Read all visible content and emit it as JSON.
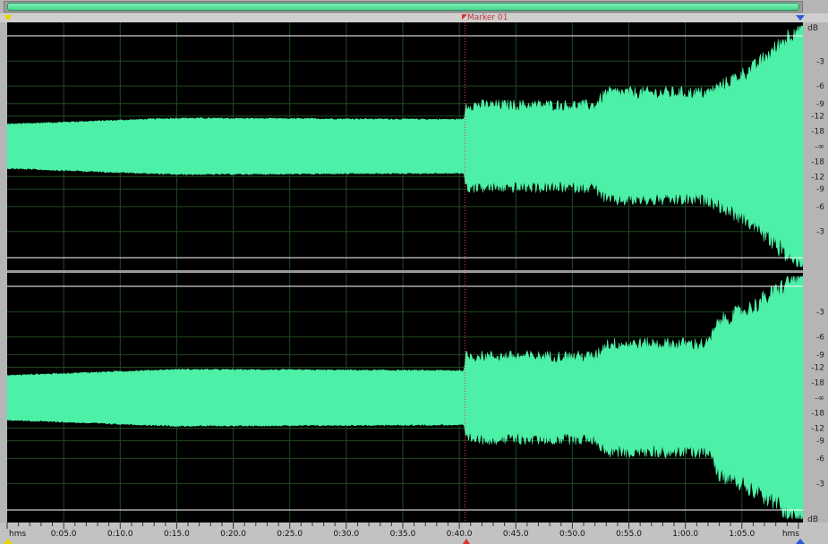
{
  "marker": {
    "label": "Marker 01",
    "time_sec": 40.5
  },
  "colors": {
    "waveform": "#4cf0a6",
    "background": "#000000",
    "grid": "#1f4a1f",
    "center_line": "#3a6a3a",
    "clip_line": "#ffffff",
    "marker_line": "#ff3b3b",
    "panel_bg": "#b5b5b5"
  },
  "ruler": {
    "unit_left": "hms",
    "unit_right": "hms",
    "ticks": [
      {
        "label": "0:05.0",
        "sec": 5
      },
      {
        "label": "0:10.0",
        "sec": 10
      },
      {
        "label": "0:15.0",
        "sec": 15
      },
      {
        "label": "0:20.0",
        "sec": 20
      },
      {
        "label": "0:25.0",
        "sec": 25
      },
      {
        "label": "0:30.0",
        "sec": 30
      },
      {
        "label": "0:35.0",
        "sec": 35
      },
      {
        "label": "0:40.0",
        "sec": 40
      },
      {
        "label": "0:45.0",
        "sec": 45
      },
      {
        "label": "0:50.0",
        "sec": 50
      },
      {
        "label": "0:55.0",
        "sec": 55
      },
      {
        "label": "1:00.0",
        "sec": 60
      },
      {
        "label": "1:05.0",
        "sec": 65
      }
    ],
    "total_sec": 70.4
  },
  "db_scale": {
    "header": "dB",
    "footer": "dB",
    "labels": [
      "-3",
      "-6",
      "-9",
      "-12",
      "-18",
      "-∞",
      "-18",
      "-12",
      "-9",
      "-6",
      "-3"
    ],
    "levels": [
      0.708,
      0.501,
      0.355,
      0.251,
      0.126,
      0,
      -0.126,
      -0.251,
      -0.355,
      -0.501,
      -0.708
    ]
  },
  "channels": [
    {
      "name": "left",
      "envelope": [
        [
          0,
          0.18
        ],
        [
          15,
          0.23
        ],
        [
          40.4,
          0.22
        ],
        [
          40.6,
          0.32
        ],
        [
          52,
          0.32
        ],
        [
          53,
          0.42
        ],
        [
          62,
          0.42
        ],
        [
          63,
          0.47
        ],
        [
          66,
          0.62
        ],
        [
          68,
          0.78
        ],
        [
          69.5,
          0.92
        ],
        [
          70.4,
          0.97
        ]
      ]
    },
    {
      "name": "right",
      "envelope": [
        [
          0,
          0.18
        ],
        [
          15,
          0.23
        ],
        [
          40.4,
          0.22
        ],
        [
          40.6,
          0.32
        ],
        [
          52,
          0.32
        ],
        [
          53,
          0.42
        ],
        [
          62,
          0.42
        ],
        [
          63,
          0.6
        ],
        [
          66,
          0.72
        ],
        [
          68,
          0.84
        ],
        [
          69.5,
          0.95
        ],
        [
          70.4,
          0.99
        ]
      ]
    }
  ]
}
